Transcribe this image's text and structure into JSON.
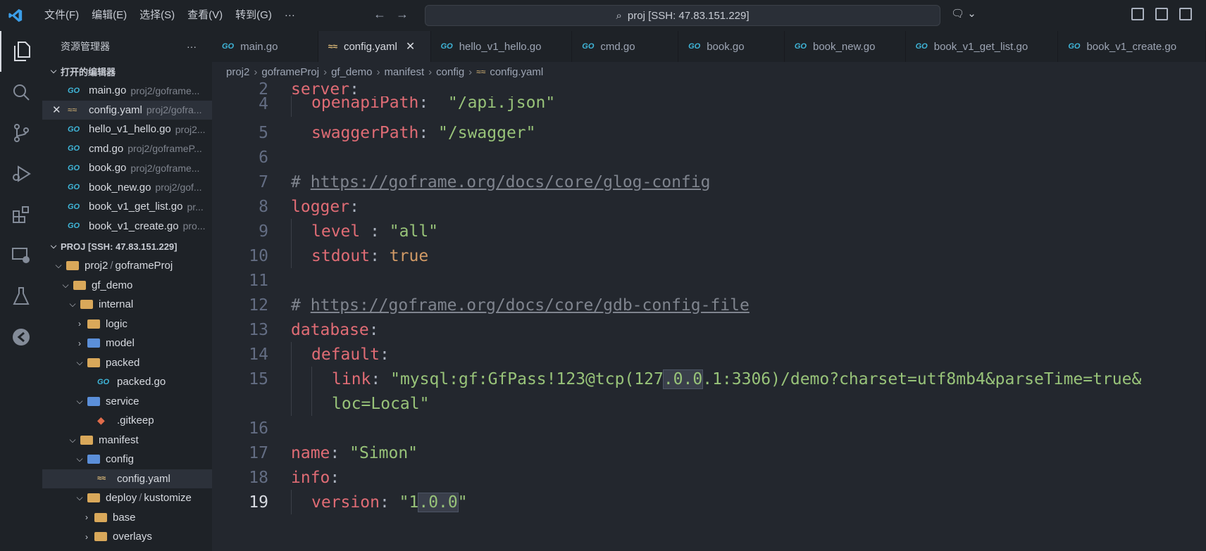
{
  "titlebar": {
    "menus": [
      "文件(F)",
      "编辑(E)",
      "选择(S)",
      "查看(V)",
      "转到(G)",
      "···"
    ],
    "search": "proj [SSH: 47.83.151.229]"
  },
  "sidebar": {
    "title": "资源管理器",
    "more": "···",
    "open_editors_label": "打开的编辑器",
    "open_editors": [
      {
        "name": "main.go",
        "path": "proj2/goframe...",
        "type": "go"
      },
      {
        "name": "config.yaml",
        "path": "proj2/gofra...",
        "type": "yaml"
      },
      {
        "name": "hello_v1_hello.go",
        "path": "proj2...",
        "type": "go"
      },
      {
        "name": "cmd.go",
        "path": "proj2/goframeP...",
        "type": "go"
      },
      {
        "name": "book.go",
        "path": "proj2/goframe...",
        "type": "go"
      },
      {
        "name": "book_new.go",
        "path": "proj2/gof...",
        "type": "go"
      },
      {
        "name": "book_v1_get_list.go",
        "path": "pr...",
        "type": "go"
      },
      {
        "name": "book_v1_create.go",
        "path": "pro...",
        "type": "go"
      }
    ],
    "workspace_label": "PROJ [SSH: 47.83.151.229]",
    "tree": {
      "proj2": "proj2",
      "sep": "/",
      "goframeProj": "goframeProj",
      "gf_demo": "gf_demo",
      "internal": "internal",
      "logic": "logic",
      "model": "model",
      "packed": "packed",
      "packed_go": "packed.go",
      "service": "service",
      "gitkeep": ".gitkeep",
      "manifest": "manifest",
      "config": "config",
      "config_yaml": "config.yaml",
      "deploy": "deploy",
      "kustomize": "kustomize",
      "base": "base",
      "overlays": "overlays"
    }
  },
  "tabs": [
    {
      "label": "main.go",
      "type": "go"
    },
    {
      "label": "config.yaml",
      "type": "yaml",
      "active": true
    },
    {
      "label": "hello_v1_hello.go",
      "type": "go"
    },
    {
      "label": "cmd.go",
      "type": "go"
    },
    {
      "label": "book.go",
      "type": "go"
    },
    {
      "label": "book_new.go",
      "type": "go"
    },
    {
      "label": "book_v1_get_list.go",
      "type": "go"
    },
    {
      "label": "book_v1_create.go",
      "type": "go"
    }
  ],
  "breadcrumb": [
    "proj2",
    "goframeProj",
    "gf_demo",
    "manifest",
    "config",
    "config.yaml"
  ],
  "editor": {
    "line_numbers": [
      "2",
      "4",
      "5",
      "6",
      "7",
      "8",
      "9",
      "10",
      "11",
      "12",
      "13",
      "14",
      "15",
      "16",
      "17",
      "18",
      "19"
    ],
    "server_key": "server",
    "openapi_key": "openapiPath",
    "openapi_val": "\"/api.json\"",
    "swagger_key": "swaggerPath",
    "swagger_val": "\"/swagger\"",
    "hash": "#",
    "glog_url": "https://goframe.org/docs/core/glog-config",
    "logger_key": "logger",
    "level_key": "level",
    "level_val": "\"all\"",
    "stdout_key": "stdout",
    "stdout_val": "true",
    "gdb_url": "https://goframe.org/docs/core/gdb-config-file",
    "database_key": "database",
    "default_key": "default",
    "link_key": "link",
    "link_val_a": "\"mysql:gf:GfPass!123@tcp(127",
    "link_val_hl": ".0.0",
    "link_val_b": ".1:3306)/demo?charset=utf8mb4&parseTime=true&",
    "link_val_c": "loc=Local\"",
    "name_key": "name",
    "name_val": "\"Simon\"",
    "info_key": "info",
    "version_key": "version",
    "version_val_a": "\"1",
    "version_val_hl": ".0.0",
    "version_val_b": "\""
  },
  "colors": {
    "key": "#e06c75",
    "string": "#98c379",
    "bool": "#d19a66",
    "comment": "#7f848e",
    "go_icon": "#3fb6d9"
  }
}
